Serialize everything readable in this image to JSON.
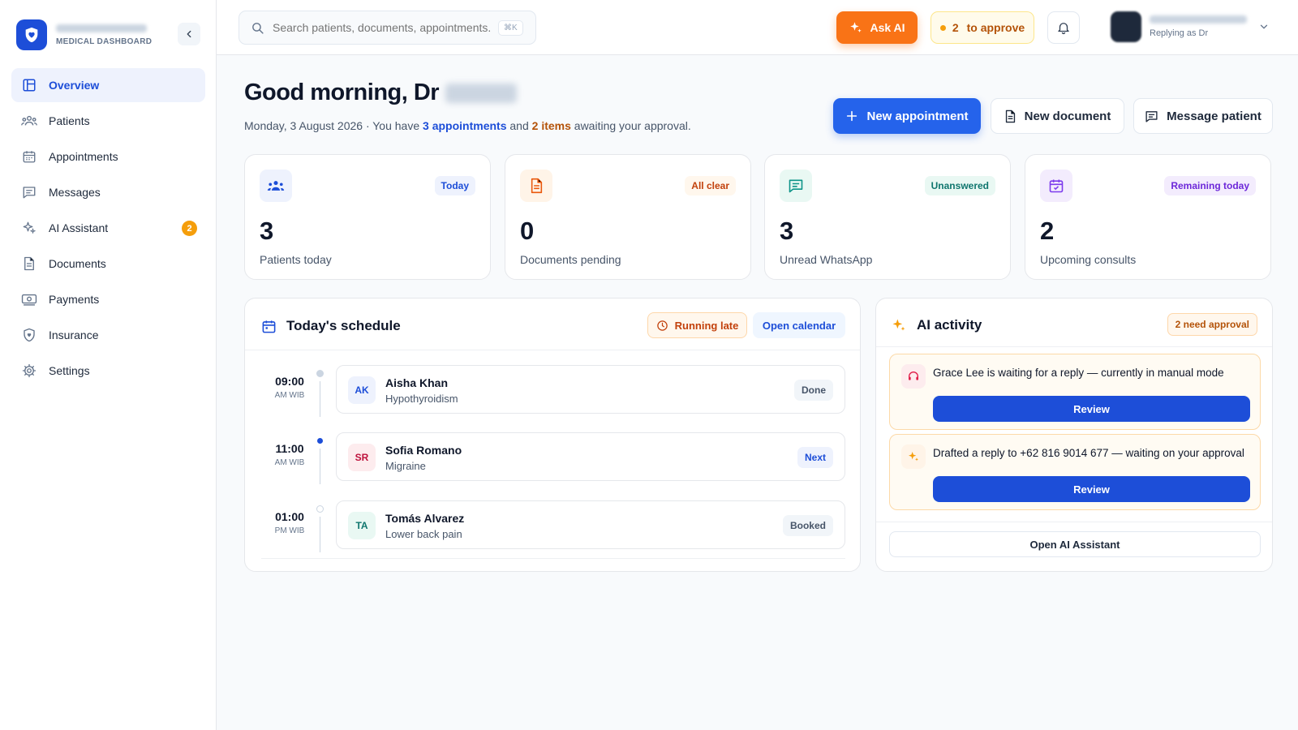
{
  "brand": {
    "subtitle": "MEDICAL DASHBOARD"
  },
  "sidebar": {
    "items": [
      {
        "label": "Overview",
        "icon": "layout-icon"
      },
      {
        "label": "Patients",
        "icon": "users-icon"
      },
      {
        "label": "Appointments",
        "icon": "calendar-icon"
      },
      {
        "label": "Messages",
        "icon": "message-icon"
      },
      {
        "label": "AI Assistant",
        "icon": "sparkle-icon",
        "badge": "2"
      },
      {
        "label": "Documents",
        "icon": "document-icon"
      },
      {
        "label": "Payments",
        "icon": "cash-icon"
      },
      {
        "label": "Insurance",
        "icon": "shield-icon"
      },
      {
        "label": "Settings",
        "icon": "gear-icon"
      }
    ]
  },
  "topbar": {
    "search_placeholder": "Search patients, documents, appointments...",
    "search_shortcut": "⌘K",
    "ask_ai": "Ask AI",
    "approve_count": "2",
    "approve_label": "to approve",
    "user_sub": "Replying as Dr"
  },
  "greeting": {
    "title": "Good morning, Dr",
    "date_prefix": "Monday, 3 August 2026 · You have",
    "appointments": "3 appointments",
    "and": "and",
    "items": "2 items",
    "suffix": "awaiting your approval."
  },
  "actions": {
    "new_appointment": "New appointment",
    "new_document": "New document",
    "message_patient": "Message patient"
  },
  "stats": [
    {
      "value": "3",
      "label": "Patients today",
      "chip": "Today"
    },
    {
      "value": "0",
      "label": "Documents pending",
      "chip": "All clear"
    },
    {
      "value": "3",
      "label": "Unread WhatsApp",
      "chip": "Unanswered"
    },
    {
      "value": "2",
      "label": "Upcoming consults",
      "chip": "Remaining today"
    }
  ],
  "schedule": {
    "title": "Today's schedule",
    "running_late": "Running late",
    "open_calendar": "Open calendar",
    "slots": [
      {
        "time": "09:00",
        "period": "AM WIB",
        "initials": "AK",
        "name": "Aisha Khan",
        "condition": "Hypothyroidism",
        "status": "Done"
      },
      {
        "time": "11:00",
        "period": "AM WIB",
        "initials": "SR",
        "name": "Sofia Romano",
        "condition": "Migraine",
        "status": "Next"
      },
      {
        "time": "01:00",
        "period": "PM WIB",
        "initials": "TA",
        "name": "Tomás Alvarez",
        "condition": "Lower back pain",
        "status": "Booked"
      }
    ]
  },
  "ai_activity": {
    "title": "AI activity",
    "need_approval": "2 need approval",
    "items": [
      {
        "text": "Grace Lee is waiting for a reply — currently in manual mode",
        "button": "Review"
      },
      {
        "text": "Drafted a reply to +62 816 9014 677 — waiting on your approval",
        "button": "Review"
      }
    ],
    "open_assistant": "Open AI Assistant"
  },
  "colors": {
    "primary": "#2563eb",
    "accent_orange": "#f97316",
    "amber": "#f59e0b",
    "teal": "#0d9488",
    "purple": "#7c3aed"
  }
}
